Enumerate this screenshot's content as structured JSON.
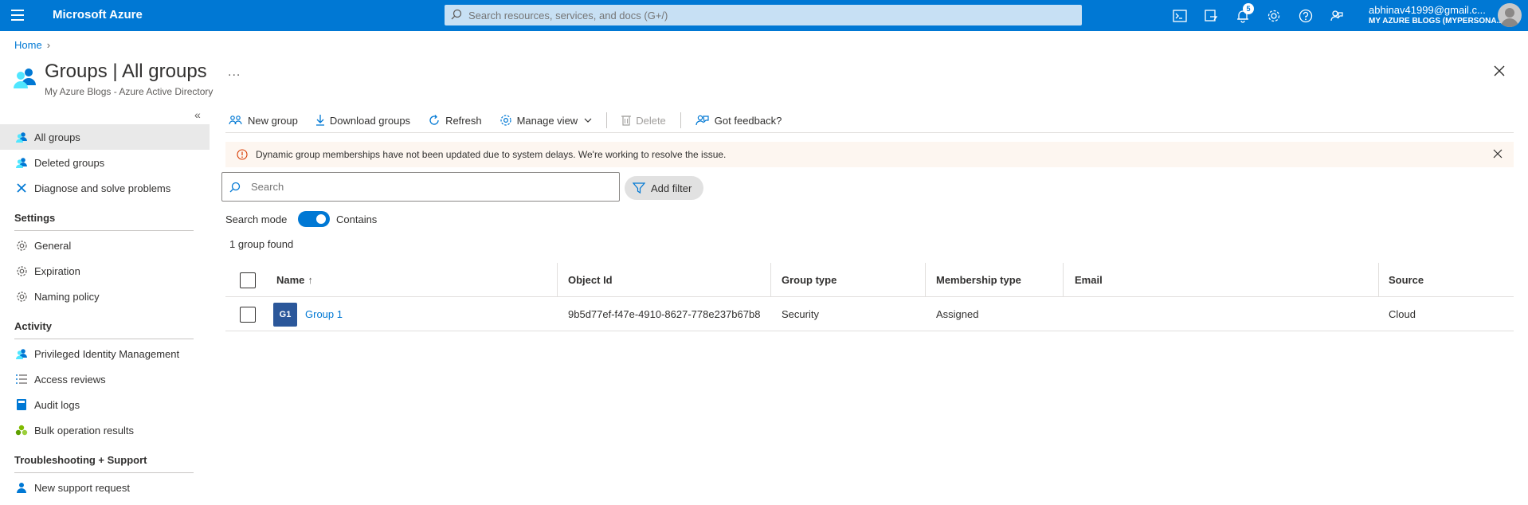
{
  "topbar": {
    "brand": "Microsoft Azure",
    "search_placeholder": "Search resources, services, and docs (G+/)",
    "notification_count": "5",
    "account_email": "abhinav41999@gmail.c...",
    "account_tenant": "MY AZURE BLOGS (MYPERSONA..."
  },
  "breadcrumb": {
    "home": "Home"
  },
  "blade": {
    "title": "Groups | All groups",
    "subtitle": "My Azure Blogs - Azure Active Directory",
    "more": "..."
  },
  "sidebar": {
    "items": [
      {
        "label": "All groups",
        "icon": "groups-icon"
      },
      {
        "label": "Deleted groups",
        "icon": "groups-icon"
      },
      {
        "label": "Diagnose and solve problems",
        "icon": "wrench-icon"
      }
    ],
    "settings_title": "Settings",
    "settings": [
      {
        "label": "General",
        "icon": "gear-icon"
      },
      {
        "label": "Expiration",
        "icon": "gear-icon"
      },
      {
        "label": "Naming policy",
        "icon": "gear-icon"
      }
    ],
    "activity_title": "Activity",
    "activity": [
      {
        "label": "Privileged Identity Management",
        "icon": "pim-icon"
      },
      {
        "label": "Access reviews",
        "icon": "list-icon"
      },
      {
        "label": "Audit logs",
        "icon": "book-icon"
      },
      {
        "label": "Bulk operation results",
        "icon": "bulk-icon"
      }
    ],
    "support_title": "Troubleshooting + Support",
    "support": [
      {
        "label": "New support request",
        "icon": "support-icon"
      }
    ]
  },
  "toolbar": {
    "new_group": "New group",
    "download_groups": "Download groups",
    "refresh": "Refresh",
    "manage_view": "Manage view",
    "delete": "Delete",
    "feedback": "Got feedback?"
  },
  "banner": {
    "message": "Dynamic group memberships have not been updated due to system delays. We're working to resolve the issue."
  },
  "filter": {
    "search_placeholder": "Search",
    "add_filter": "Add filter",
    "search_mode_label": "Search mode",
    "search_mode_value": "Contains",
    "result_count": "1 group found"
  },
  "table": {
    "columns": {
      "name": "Name",
      "sort_indicator": "↑",
      "object_id": "Object Id",
      "group_type": "Group type",
      "membership_type": "Membership type",
      "email": "Email",
      "source": "Source"
    },
    "rows": [
      {
        "avatar": "G1",
        "name": "Group 1",
        "object_id": "9b5d77ef-f47e-4910-8627-778e237b67b8",
        "group_type": "Security",
        "membership_type": "Assigned",
        "email": "",
        "source": "Cloud"
      }
    ]
  },
  "colors": {
    "accent": "#0078d4",
    "banner_bg": "#fdf6f0",
    "warning": "#d83b01",
    "avatar_bg": "#2b579a"
  }
}
